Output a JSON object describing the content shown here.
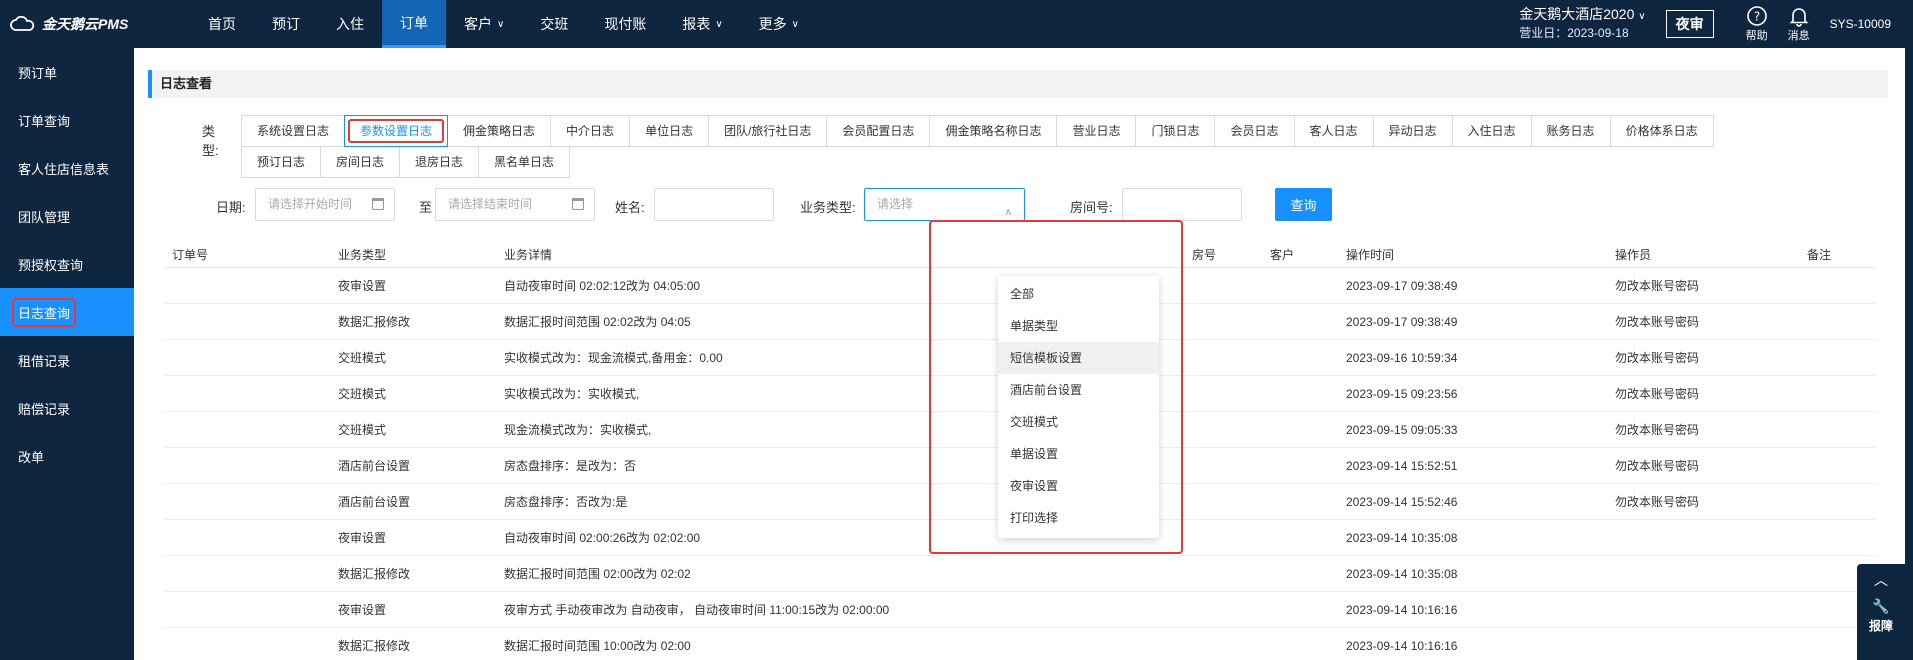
{
  "app": {
    "logo_text": "金天鹅云PMS"
  },
  "nav": [
    {
      "label": "首页",
      "active": false,
      "dropdown": false
    },
    {
      "label": "预订",
      "active": false,
      "dropdown": false
    },
    {
      "label": "入住",
      "active": false,
      "dropdown": false
    },
    {
      "label": "订单",
      "active": true,
      "dropdown": false
    },
    {
      "label": "客户",
      "active": false,
      "dropdown": true
    },
    {
      "label": "交班",
      "active": false,
      "dropdown": false
    },
    {
      "label": "现付账",
      "active": false,
      "dropdown": false
    },
    {
      "label": "报表",
      "active": false,
      "dropdown": true
    },
    {
      "label": "更多",
      "active": false,
      "dropdown": true
    }
  ],
  "header": {
    "hotel_name": "金天鹅大酒店2020",
    "business_date": "营业日：2023-09-18",
    "night_audit": "夜审",
    "help": "帮助",
    "message": "消息",
    "user": "SYS-10009"
  },
  "sidebar": [
    {
      "label": "预订单",
      "active": false
    },
    {
      "label": "订单查询",
      "active": false
    },
    {
      "label": "客人住店信息表",
      "active": false
    },
    {
      "label": "团队管理",
      "active": false
    },
    {
      "label": "预授权查询",
      "active": false
    },
    {
      "label": "日志查询",
      "active": true
    },
    {
      "label": "租借记录",
      "active": false
    },
    {
      "label": "赔偿记录",
      "active": false
    },
    {
      "label": "改单",
      "active": false
    }
  ],
  "page": {
    "title": "日志查看",
    "type_label": "类型:",
    "type_tabs": [
      "系统设置日志",
      "参数设置日志",
      "佣金策略日志",
      "中介日志",
      "单位日志",
      "团队/旅行社日志",
      "会员配置日志",
      "佣金策略名称日志",
      "营业日志",
      "门锁日志",
      "会员日志",
      "客人日志",
      "异动日志",
      "入住日志",
      "账务日志",
      "价格体系日志",
      "预订日志",
      "房间日志",
      "退房日志",
      "黑名单日志"
    ],
    "active_type": 1
  },
  "filters": {
    "date_label": "日期:",
    "start_placeholder": "请选择开始时间",
    "to": "至",
    "end_placeholder": "请选择结束时间",
    "name_label": "姓名:",
    "biz_type_label": "业务类型:",
    "biz_type_placeholder": "请选择",
    "room_label": "房间号:",
    "query_button": "查询"
  },
  "dropdown": {
    "options": [
      "全部",
      "单据类型",
      "短信模板设置",
      "酒店前台设置",
      "交班模式",
      "单据设置",
      "夜审设置",
      "打印选择"
    ],
    "hover_index": 2
  },
  "table": {
    "columns": [
      "订单号",
      "业务类型",
      "业务详情",
      "房号",
      "客户",
      "操作时间",
      "操作员",
      "备注"
    ],
    "rows": [
      [
        "",
        "夜审设置",
        "自动夜审时间 02:02:12改为 04:05:00",
        "",
        "",
        "2023-09-17 09:38:49",
        "勿改本账号密码",
        ""
      ],
      [
        "",
        "数据汇报修改",
        "数据汇报时间范围 02:02改为 04:05",
        "",
        "",
        "2023-09-17 09:38:49",
        "勿改本账号密码",
        ""
      ],
      [
        "",
        "交班模式",
        "实收模式改为：现金流模式,备用金：0.00",
        "",
        "",
        "2023-09-16 10:59:34",
        "勿改本账号密码",
        ""
      ],
      [
        "",
        "交班模式",
        "实收模式改为：实收模式,",
        "",
        "",
        "2023-09-15 09:23:56",
        "勿改本账号密码",
        ""
      ],
      [
        "",
        "交班模式",
        "现金流模式改为：实收模式,",
        "",
        "",
        "2023-09-15 09:05:33",
        "勿改本账号密码",
        ""
      ],
      [
        "",
        "酒店前台设置",
        "房态盘排序：是改为：否",
        "",
        "",
        "2023-09-14 15:52:51",
        "勿改本账号密码",
        ""
      ],
      [
        "",
        "酒店前台设置",
        "房态盘排序：否改为:是",
        "",
        "",
        "2023-09-14 15:52:46",
        "勿改本账号密码",
        ""
      ],
      [
        "",
        "夜审设置",
        "自动夜审时间 02:00:26改为 02:02:00",
        "",
        "",
        "2023-09-14 10:35:08",
        "",
        ""
      ],
      [
        "",
        "数据汇报修改",
        "数据汇报时间范围 02:00改为 02:02",
        "",
        "",
        "2023-09-14 10:35:08",
        "",
        ""
      ],
      [
        "",
        "夜审设置",
        "夜审方式 手动夜审改为 自动夜审， 自动夜审时间 11:00:15改为 02:00:00",
        "",
        "",
        "2023-09-14 10:16:16",
        "",
        ""
      ],
      [
        "",
        "数据汇报修改",
        "数据汇报时间范围 10:00改为 02:00",
        "",
        "",
        "2023-09-14 10:16:16",
        "",
        ""
      ]
    ]
  },
  "widget": {
    "label": "报障"
  },
  "colors": {
    "nav_bg": "#0f2640",
    "accent": "#1890ff",
    "highlight": "#e53935"
  }
}
